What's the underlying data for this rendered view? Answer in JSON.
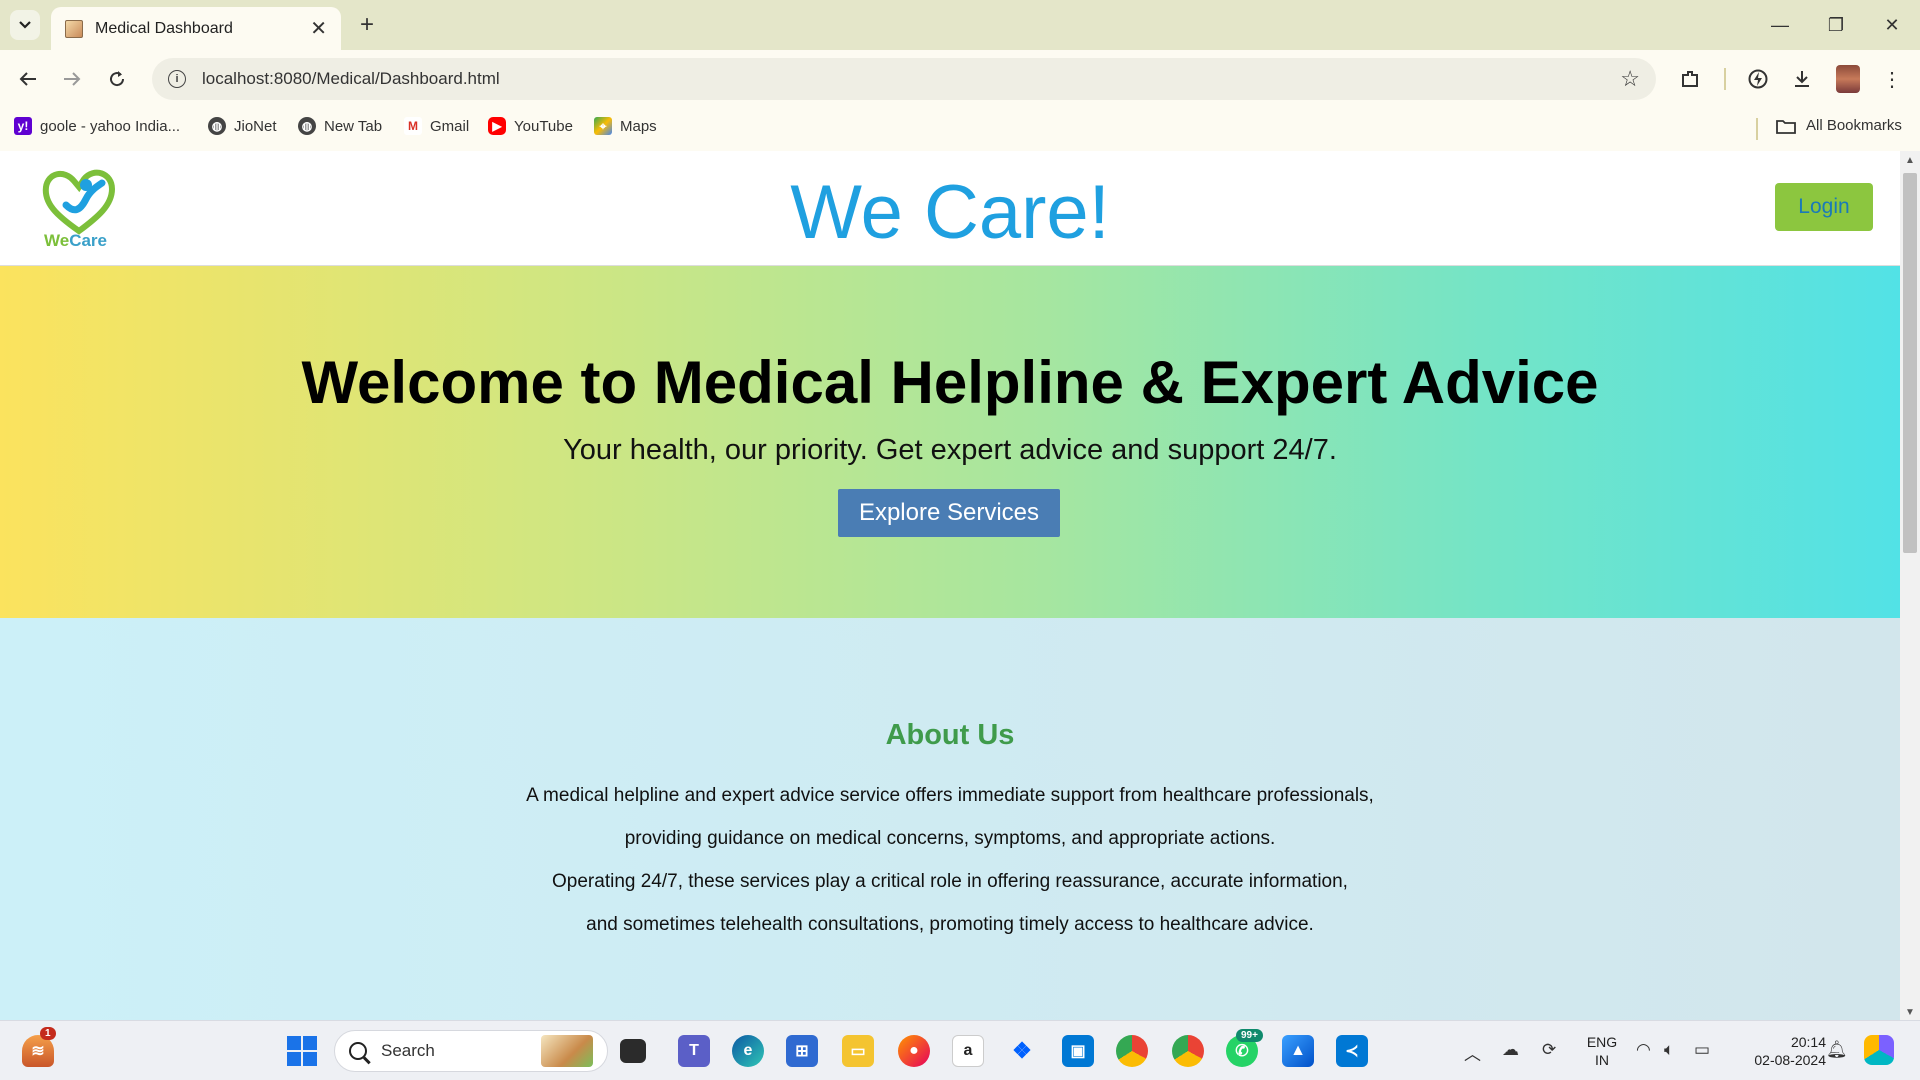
{
  "browser": {
    "tab_title": "Medical Dashboard",
    "url": "localhost:8080/Medical/Dashboard.html",
    "bookmarks": [
      {
        "label": "goole - yahoo India...",
        "icon": "yahoo-icon"
      },
      {
        "label": "JioNet",
        "icon": "globe-icon"
      },
      {
        "label": "New Tab",
        "icon": "globe-icon"
      },
      {
        "label": "Gmail",
        "icon": "gmail-icon"
      },
      {
        "label": "YouTube",
        "icon": "youtube-icon"
      },
      {
        "label": "Maps",
        "icon": "maps-icon"
      }
    ],
    "all_bookmarks": "All Bookmarks"
  },
  "site": {
    "logo_text_we": "We",
    "logo_text_care": "Care",
    "title": "We Care!",
    "login_label": "Login"
  },
  "hero": {
    "title": "Welcome to Medical Helpline & Expert Advice",
    "subtitle": "Your health, our priority. Get expert advice and support 24/7.",
    "button_label": "Explore Services"
  },
  "about": {
    "title": "About Us",
    "lines": [
      "A medical helpline and expert advice service offers immediate support from healthcare professionals,",
      "providing guidance on medical concerns, symptoms, and appropriate actions.",
      "Operating 24/7, these services play a critical role in offering reassurance, accurate information,",
      "and sometimes telehealth consultations, promoting timely access to healthcare advice."
    ]
  },
  "taskbar": {
    "search_label": "Search",
    "weather_badge": "1",
    "whatsapp_badge": "99+",
    "lang_line1": "ENG",
    "lang_line2": "IN",
    "time": "20:14",
    "date": "02-08-2024"
  },
  "colors": {
    "brand_blue": "#1fa0e0",
    "login_green": "#8cc63f",
    "about_green": "#3f9b4b",
    "explore_blue": "#4a7db4"
  }
}
